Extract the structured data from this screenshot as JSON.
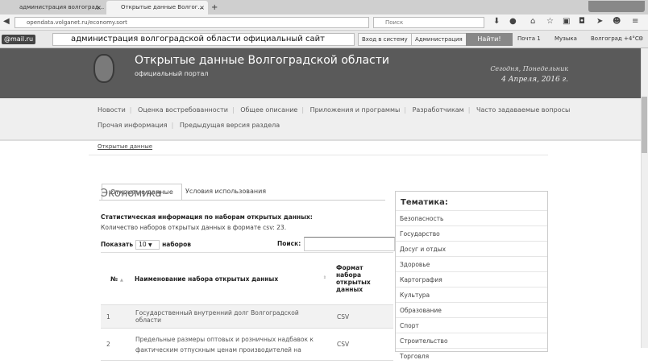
{
  "browser": {
    "tabs": [
      {
        "label": "администрация волгоград...",
        "active": false
      },
      {
        "label": "Открытые данные Волгог...",
        "active": true
      }
    ],
    "new_tab": "+",
    "url": "opendata.volganet.ru/economy.sort",
    "search_placeholder": "Поиск"
  },
  "mailbar": {
    "logo": "@mail.ru",
    "query": "администрация волгоградской области официальный сайт",
    "login": "Вход в систему",
    "admin": "Администрация",
    "find": "Найти!",
    "mail": "Почта 1",
    "music": "Музыка",
    "weather": "Волгоград +4°C"
  },
  "header": {
    "title": "Открытые данные Волгоградской области",
    "subtitle": "официальный портал",
    "today": "Сегодня, Понедельник",
    "date": "4 Апреля, 2016 г."
  },
  "menu": {
    "row1": [
      "Новости",
      "Оценка востребованности",
      "Общее описание",
      "Приложения и программы",
      "Разработчикам",
      "Часто задаваемые вопросы"
    ],
    "row2": [
      "Прочая информация",
      "Предыдущая версия раздела"
    ]
  },
  "breadcrumb": "Открытые данные",
  "content_tabs": [
    "Открытые данные",
    "Условия использования"
  ],
  "page_title": "Экономика",
  "stats_title": "Статистическая информация по наборам открытых данных:",
  "stats_count": "Количество наборов открытых данных в формате csv: 23.",
  "show": {
    "prefix": "Показать",
    "value": "10",
    "suffix": "наборов"
  },
  "search_label": "Поиск:",
  "table": {
    "headers": [
      "№",
      "Наименование набора открытых данных",
      "Формат набора открытых данных"
    ],
    "rows": [
      {
        "n": "1",
        "name": "Государственный внутренний долг Волгоградской области",
        "format": "CSV"
      },
      {
        "n": "2",
        "name": "Предельные размеры оптовых и розничных надбавок к фактическим отпускным ценам производителей на",
        "format": "CSV"
      }
    ]
  },
  "sidebar": {
    "title": "Тематика:",
    "items": [
      "Безопасность",
      "Государство",
      "Досуг и отдых",
      "Здоровье",
      "Картография",
      "Культура",
      "Образование",
      "Спорт",
      "Строительство",
      "Торговля"
    ]
  }
}
